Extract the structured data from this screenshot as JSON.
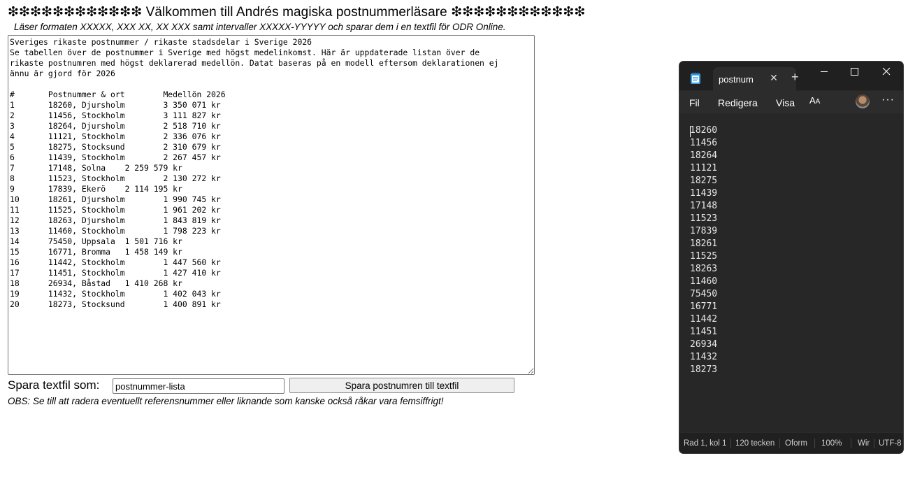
{
  "page": {
    "title": "❇❇❇❇❇❇❇❇❇❇❇❇ Välkommen till Andrés magiska postnummerläsare ❇❇❇❇❇❇❇❇❇❇❇❇",
    "subtitle": "Läser formaten XXXXX, XXX XX, XX XXX samt intervaller XXXXX-YYYYY och sparar dem i en textfil för ODR Online.",
    "textarea_value": "Sveriges rikaste postnummer / rikaste stadsdelar i Sverige 2026\nSe tabellen över de postnummer i Sverige med högst medelinkomst. Här är uppdaterade listan över de\nrikaste postnumren med högst deklarerad medellön. Datat baseras på en modell eftersom deklarationen ej\nännu är gjord för 2026\n\n#\tPostnummer & ort\tMedellön 2026\n1\t18260, Djursholm\t3 350 071 kr\n2\t11456, Stockholm\t3 111 827 kr\n3\t18264, Djursholm\t2 518 710 kr\n4\t11121, Stockholm\t2 336 076 kr\n5\t18275, Stocksund\t2 310 679 kr\n6\t11439, Stockholm\t2 267 457 kr\n7\t17148, Solna\t2 259 579 kr\n8\t11523, Stockholm\t2 130 272 kr\n9\t17839, Ekerö\t2 114 195 kr\n10\t18261, Djursholm\t1 990 745 kr\n11\t11525, Stockholm\t1 961 202 kr\n12\t18263, Djursholm\t1 843 819 kr\n13\t11460, Stockholm\t1 798 223 kr\n14\t75450, Uppsala\t1 501 716 kr\n15\t16771, Bromma\t1 458 149 kr\n16\t11442, Stockholm\t1 447 560 kr\n17\t11451, Stockholm\t1 427 410 kr\n18\t26934, Båstad\t1 410 268 kr\n19\t11432, Stockholm\t1 402 043 kr\n20\t18273, Stocksund\t1 400 891 kr",
    "save_label": "Spara textfil som:",
    "filename_value": "postnummer-lista",
    "save_button": "Spara postnumren till textfil",
    "note": "OBS: Se till att radera eventuellt referensnummer eller liknande som kanske också råkar vara femsiffrigt!"
  },
  "notepad": {
    "tab_title": "postnum",
    "menu": [
      "Fil",
      "Redigera",
      "Visa"
    ],
    "lines": [
      "18260",
      "11456",
      "18264",
      "11121",
      "18275",
      "11439",
      "17148",
      "11523",
      "17839",
      "18261",
      "11525",
      "18263",
      "11460",
      "75450",
      "16771",
      "11442",
      "11451",
      "26934",
      "11432",
      "18273"
    ],
    "status": {
      "position": "Rad 1, kol 1",
      "chars": "120 tecken",
      "format": "Oform",
      "zoom": "100%",
      "line_ending": "Wir",
      "encoding": "UTF-8"
    },
    "colors": {
      "background": "#272727",
      "titlebar": "#202020",
      "tab": "#2c2c2c"
    }
  }
}
